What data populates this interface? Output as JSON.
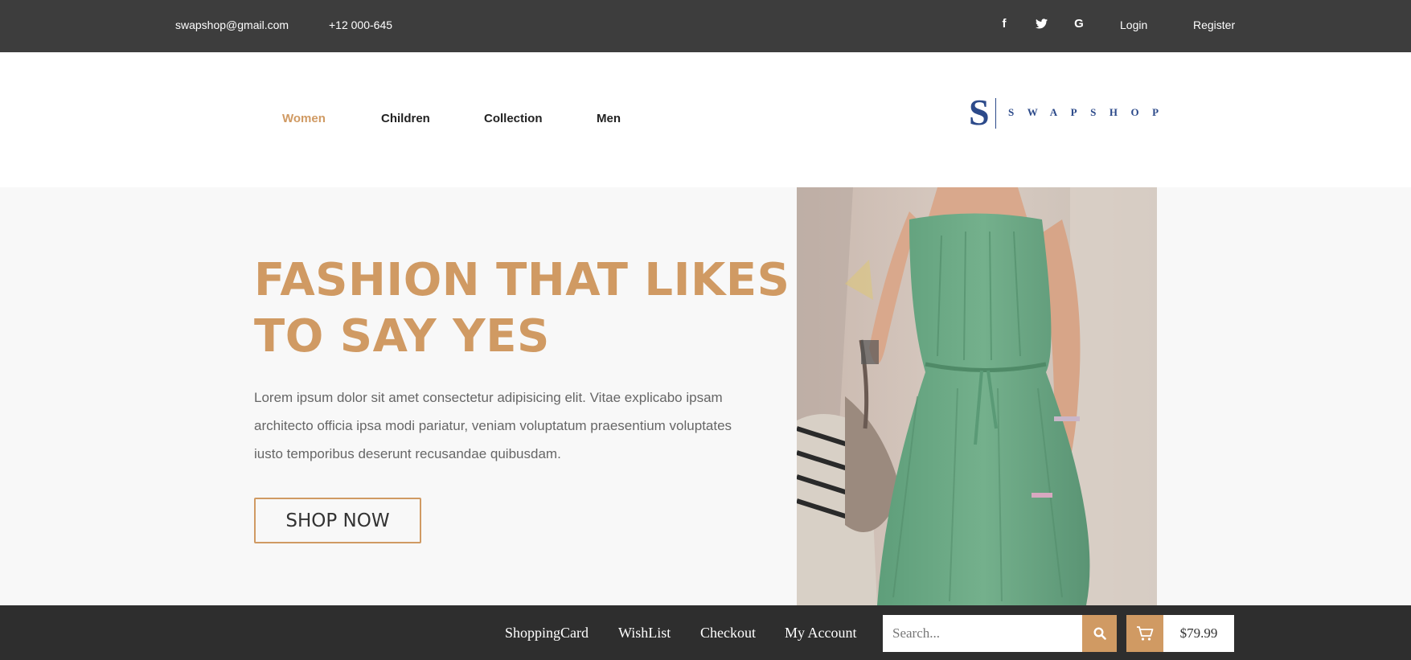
{
  "topbar": {
    "email": "swapshop@gmail.com",
    "phone": "+12 000-645",
    "social": [
      {
        "icon": "facebook-icon",
        "glyph": "f"
      },
      {
        "icon": "twitter-icon",
        "glyph": "t"
      },
      {
        "icon": "google-icon",
        "glyph": "G"
      }
    ],
    "login_label": "Login",
    "register_label": "Register"
  },
  "nav": {
    "items": [
      {
        "label": "Women",
        "active": true
      },
      {
        "label": "Children",
        "active": false
      },
      {
        "label": "Collection",
        "active": false
      },
      {
        "label": "Men",
        "active": false
      }
    ]
  },
  "logo": {
    "mark": "S",
    "wordmark": "SWAPSHOP"
  },
  "hero": {
    "title_line1": "FASHION THAT LIKES",
    "title_line2": "TO SAY YES",
    "text": "Lorem ipsum dolor sit amet consectetur adipisicing elit. Vitae explicabo ipsam architecto officia ipsa modi pariatur, veniam voluptatum praesentium voluptates iusto temporibus deserunt recusandae quibusdam.",
    "cta_label": "SHOP NOW",
    "image": "woman-in-green-dress-photo"
  },
  "bottombar": {
    "links": [
      "ShoppingCard",
      "WishList",
      "Checkout",
      "My Account"
    ],
    "search_placeholder": "Search...",
    "cart_total": "$79.99"
  },
  "colors": {
    "accent": "#d09a63",
    "topbar_bg": "#3d3d3d",
    "bottombar_bg": "#2e2e2e",
    "logo_blue": "#2c4a8a",
    "hero_bg": "#f8f8f8"
  }
}
